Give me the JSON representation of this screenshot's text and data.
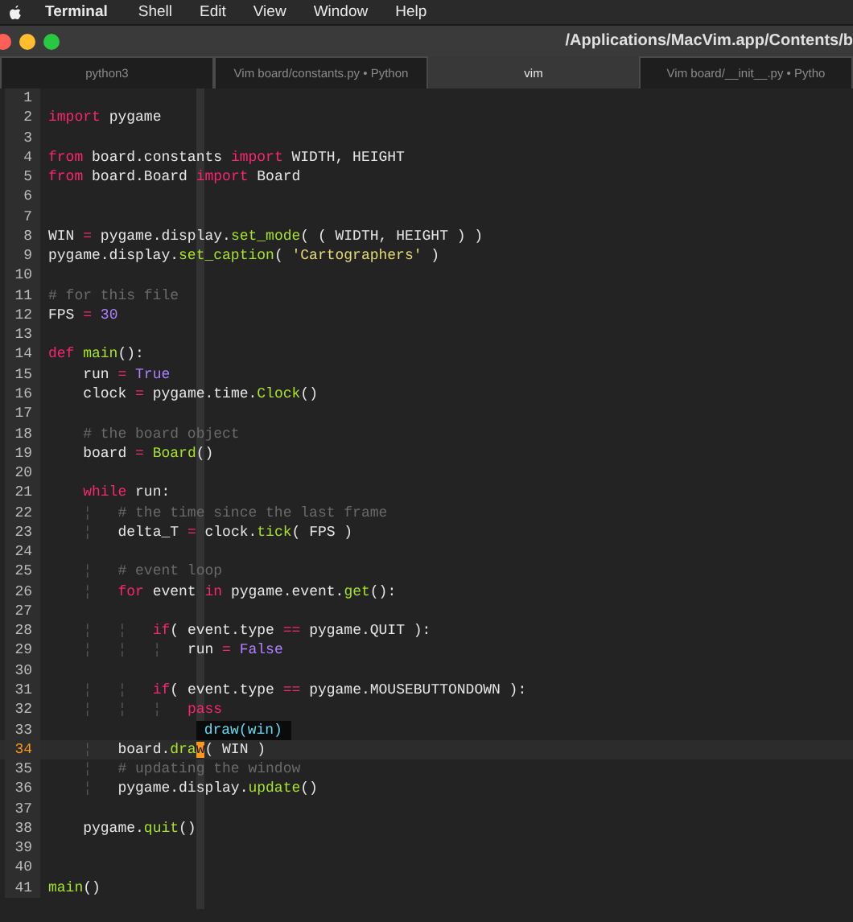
{
  "menu_bar": {
    "app": "Terminal",
    "items": [
      "Shell",
      "Edit",
      "View",
      "Window",
      "Help"
    ]
  },
  "window": {
    "title": "/Applications/MacVim.app/Contents/b"
  },
  "tabs": [
    {
      "label": "python3",
      "selected": false
    },
    {
      "label": "Vim board/constants.py • Python",
      "selected": false
    },
    {
      "label": "vim",
      "selected": true
    },
    {
      "label": "Vim board/__init__.py • Pytho",
      "selected": false
    }
  ],
  "editor": {
    "lines": [
      {
        "number": "1",
        "current": false
      },
      {
        "number": "2",
        "current": false,
        "tokens": [
          {
            "text": "import",
            "kind": "keyword"
          },
          {
            "text": " pygame",
            "kind": "plain"
          }
        ]
      },
      {
        "number": "3",
        "current": false
      },
      {
        "number": "4",
        "current": false,
        "tokens": [
          {
            "text": "from",
            "kind": "keyword"
          },
          {
            "text": " board.constants ",
            "kind": "plain"
          },
          {
            "text": "import",
            "kind": "keyword"
          },
          {
            "text": " WIDTH, HEIGHT",
            "kind": "plain"
          }
        ]
      },
      {
        "number": "5",
        "current": false,
        "tokens": [
          {
            "text": "from",
            "kind": "keyword"
          },
          {
            "text": " board.Board ",
            "kind": "plain"
          },
          {
            "text": "import",
            "kind": "keyword"
          },
          {
            "text": " Board",
            "kind": "plain"
          }
        ]
      },
      {
        "number": "6",
        "current": false
      },
      {
        "number": "7",
        "current": false
      },
      {
        "number": "8",
        "current": false,
        "tokens": [
          {
            "text": "WIN ",
            "kind": "plain"
          },
          {
            "text": "=",
            "kind": "operator"
          },
          {
            "text": " pygame.display.",
            "kind": "plain"
          },
          {
            "text": "set_mode",
            "kind": "function"
          },
          {
            "text": "( ( WIDTH, HEIGHT ) )",
            "kind": "plain"
          }
        ]
      },
      {
        "number": "9",
        "current": false,
        "tokens": [
          {
            "text": "pygame.display.",
            "kind": "plain"
          },
          {
            "text": "set_caption",
            "kind": "function"
          },
          {
            "text": "( ",
            "kind": "plain"
          },
          {
            "text": "'Cartographers'",
            "kind": "string"
          },
          {
            "text": " )",
            "kind": "plain"
          }
        ]
      },
      {
        "number": "10",
        "current": false
      },
      {
        "number": "11",
        "current": false,
        "tokens": [
          {
            "text": "# for this file",
            "kind": "comment"
          }
        ]
      },
      {
        "number": "12",
        "current": false,
        "tokens": [
          {
            "text": "FPS ",
            "kind": "plain"
          },
          {
            "text": "= ",
            "kind": "operator"
          },
          {
            "text": "30",
            "kind": "constant"
          }
        ]
      },
      {
        "number": "13",
        "current": false
      },
      {
        "number": "14",
        "current": false,
        "tokens": [
          {
            "text": "def ",
            "kind": "keyword"
          },
          {
            "text": "main",
            "kind": "function"
          },
          {
            "text": "():",
            "kind": "plain"
          }
        ]
      },
      {
        "number": "15",
        "current": false,
        "tokens": [
          {
            "text": "    run ",
            "kind": "plain"
          },
          {
            "text": "= ",
            "kind": "operator"
          },
          {
            "text": "True",
            "kind": "constant"
          }
        ]
      },
      {
        "number": "16",
        "current": false,
        "tokens": [
          {
            "text": "    clock ",
            "kind": "plain"
          },
          {
            "text": "=",
            "kind": "operator"
          },
          {
            "text": " pygame.time.",
            "kind": "plain"
          },
          {
            "text": "Clock",
            "kind": "function"
          },
          {
            "text": "()",
            "kind": "plain"
          }
        ]
      },
      {
        "number": "17",
        "current": false
      },
      {
        "number": "18",
        "current": false,
        "tokens": [
          {
            "text": "    # the board object",
            "kind": "comment"
          }
        ]
      },
      {
        "number": "19",
        "current": false,
        "tokens": [
          {
            "text": "    board ",
            "kind": "plain"
          },
          {
            "text": "= ",
            "kind": "operator"
          },
          {
            "text": "Board",
            "kind": "function"
          },
          {
            "text": "()",
            "kind": "plain"
          }
        ]
      },
      {
        "number": "20",
        "current": false
      },
      {
        "number": "21",
        "current": false,
        "tokens": [
          {
            "text": "    while",
            "kind": "keyword"
          },
          {
            "text": " run:",
            "kind": "plain"
          }
        ]
      },
      {
        "number": "22",
        "current": false,
        "tokens": [
          {
            "text": "    ¦",
            "kind": "guide"
          },
          {
            "text": "   # the time since the last frame",
            "kind": "comment"
          }
        ]
      },
      {
        "number": "23",
        "current": false,
        "tokens": [
          {
            "text": "    ¦",
            "kind": "guide"
          },
          {
            "text": "   delta_T ",
            "kind": "plain"
          },
          {
            "text": "=",
            "kind": "operator"
          },
          {
            "text": " clock.",
            "kind": "plain"
          },
          {
            "text": "tick",
            "kind": "function"
          },
          {
            "text": "( FPS )",
            "kind": "plain"
          }
        ]
      },
      {
        "number": "24",
        "current": false
      },
      {
        "number": "25",
        "current": false,
        "tokens": [
          {
            "text": "    ¦",
            "kind": "guide"
          },
          {
            "text": "   # event loop",
            "kind": "comment"
          }
        ]
      },
      {
        "number": "26",
        "current": false,
        "tokens": [
          {
            "text": "    ¦",
            "kind": "guide"
          },
          {
            "text": "   for",
            "kind": "keyword"
          },
          {
            "text": " event ",
            "kind": "plain"
          },
          {
            "text": "in",
            "kind": "keyword"
          },
          {
            "text": " pygame.event.",
            "kind": "plain"
          },
          {
            "text": "get",
            "kind": "function"
          },
          {
            "text": "():",
            "kind": "plain"
          }
        ]
      },
      {
        "number": "27",
        "current": false
      },
      {
        "number": "28",
        "current": false,
        "tokens": [
          {
            "text": "    ¦",
            "kind": "guide"
          },
          {
            "text": "   ¦",
            "kind": "guide"
          },
          {
            "text": "   if",
            "kind": "keyword"
          },
          {
            "text": "( event.type ",
            "kind": "plain"
          },
          {
            "text": "==",
            "kind": "operator"
          },
          {
            "text": " pygame.QUIT ):",
            "kind": "plain"
          }
        ]
      },
      {
        "number": "29",
        "current": false,
        "tokens": [
          {
            "text": "    ¦",
            "kind": "guide"
          },
          {
            "text": "   ¦",
            "kind": "guide"
          },
          {
            "text": "   ¦",
            "kind": "guide"
          },
          {
            "text": "   run ",
            "kind": "plain"
          },
          {
            "text": "= ",
            "kind": "operator"
          },
          {
            "text": "False",
            "kind": "constant"
          }
        ]
      },
      {
        "number": "30",
        "current": false
      },
      {
        "number": "31",
        "current": false,
        "tokens": [
          {
            "text": "    ¦",
            "kind": "guide"
          },
          {
            "text": "   ¦",
            "kind": "guide"
          },
          {
            "text": "   if",
            "kind": "keyword"
          },
          {
            "text": "( event.type ",
            "kind": "plain"
          },
          {
            "text": "==",
            "kind": "operator"
          },
          {
            "text": " pygame.MOUSEBUTTONDOWN ):",
            "kind": "plain"
          }
        ]
      },
      {
        "number": "32",
        "current": false,
        "tokens": [
          {
            "text": "    ¦",
            "kind": "guide"
          },
          {
            "text": "   ¦",
            "kind": "guide"
          },
          {
            "text": "   ¦",
            "kind": "guide"
          },
          {
            "text": "   pass",
            "kind": "keyword"
          }
        ]
      },
      {
        "number": "33",
        "current": false,
        "completion": "draw(win)"
      },
      {
        "number": "34",
        "current": true,
        "tokens": [
          {
            "text": "    ¦",
            "kind": "guide"
          },
          {
            "text": "   board.",
            "kind": "plain"
          },
          {
            "text": "dra",
            "kind": "function"
          },
          {
            "text": "w",
            "kind": "cursor"
          },
          {
            "text": "( WIN )",
            "kind": "plain"
          }
        ]
      },
      {
        "number": "35",
        "current": false,
        "tokens": [
          {
            "text": "    ¦",
            "kind": "guide"
          },
          {
            "text": "   # updating the window",
            "kind": "comment"
          }
        ]
      },
      {
        "number": "36",
        "current": false,
        "tokens": [
          {
            "text": "    ¦",
            "kind": "guide"
          },
          {
            "text": "   pygame.display.",
            "kind": "plain"
          },
          {
            "text": "update",
            "kind": "function"
          },
          {
            "text": "()",
            "kind": "plain"
          }
        ]
      },
      {
        "number": "37",
        "current": false
      },
      {
        "number": "38",
        "current": false,
        "tokens": [
          {
            "text": "    pygame.",
            "kind": "plain"
          },
          {
            "text": "quit",
            "kind": "function"
          },
          {
            "text": "()",
            "kind": "plain"
          }
        ]
      },
      {
        "number": "39",
        "current": false
      },
      {
        "number": "40",
        "current": false
      },
      {
        "number": "41",
        "current": false,
        "tokens": [
          {
            "text": "main",
            "kind": "function"
          },
          {
            "text": "()",
            "kind": "plain"
          }
        ]
      }
    ]
  }
}
